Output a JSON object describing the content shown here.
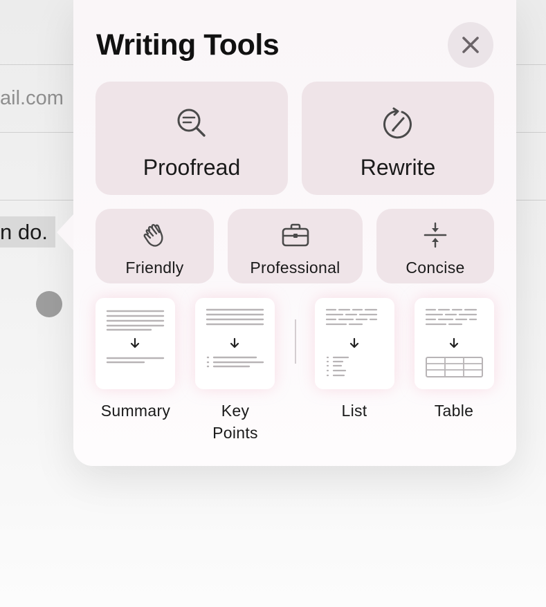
{
  "background": {
    "email_fragment": "ail.com",
    "selected_text_fragment": "n do."
  },
  "popover": {
    "title": "Writing Tools",
    "close_icon": "xmark-icon",
    "primary_actions": [
      {
        "label": "Proofread",
        "icon": "magnifier-lines-icon"
      },
      {
        "label": "Rewrite",
        "icon": "rewrite-circle-icon"
      }
    ],
    "tone_actions": [
      {
        "label": "Friendly",
        "icon": "waving-hand-icon"
      },
      {
        "label": "Professional",
        "icon": "briefcase-icon"
      },
      {
        "label": "Concise",
        "icon": "compress-arrows-icon"
      }
    ],
    "transform_actions": [
      {
        "label": "Summary",
        "icon": "summary-doc-icon"
      },
      {
        "label": "Key\nPoints",
        "label_line1": "Key",
        "label_line2": "Points",
        "icon": "key-points-doc-icon"
      },
      {
        "label": "List",
        "icon": "list-doc-icon"
      },
      {
        "label": "Table",
        "icon": "table-doc-icon"
      }
    ]
  },
  "colors": {
    "panel_bg": "#faf6f8",
    "button_bg": "#efe4e8",
    "icon_stroke": "#4a4a4a",
    "card_glow": "#f0aabe"
  }
}
